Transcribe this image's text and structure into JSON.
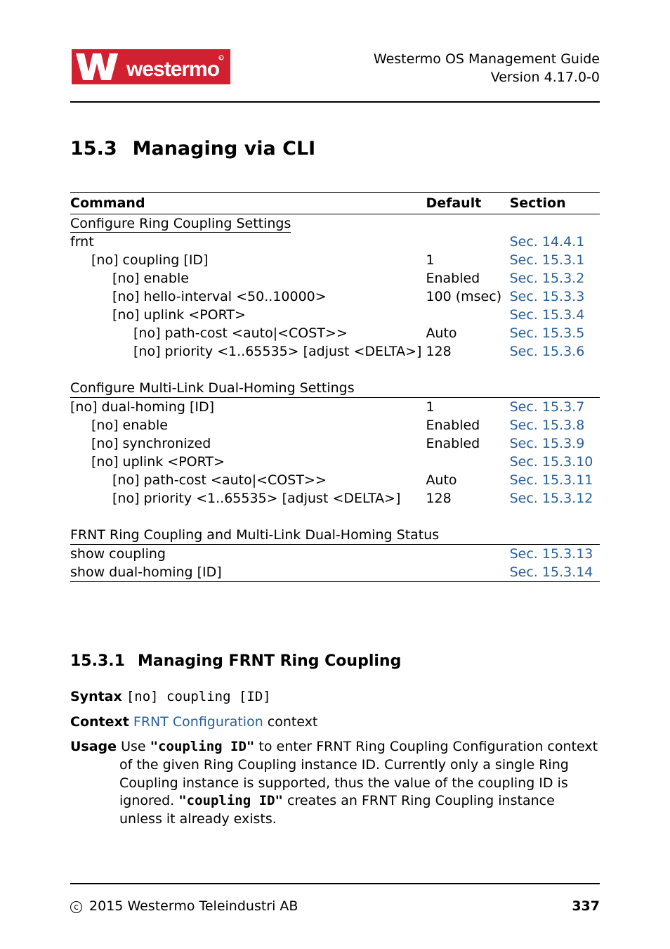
{
  "header": {
    "doc_title": "Westermo OS Management Guide",
    "doc_version": "Version 4.17.0-0",
    "logo_text": "westermo"
  },
  "section": {
    "number": "15.3",
    "title": "Managing via CLI"
  },
  "table": {
    "head_command": "Command",
    "head_default": "Default",
    "head_section": "Section",
    "group1_title": "Configure Ring Coupling Settings",
    "rows1": [
      {
        "cmd": "frnt",
        "indent": 0,
        "default": "",
        "section": "Sec. 14.4.1"
      },
      {
        "cmd": "[no] coupling [ID]",
        "indent": 1,
        "default": "1",
        "section": "Sec. 15.3.1"
      },
      {
        "cmd": "[no] enable",
        "indent": 2,
        "default": "Enabled",
        "section": "Sec. 15.3.2"
      },
      {
        "cmd": "[no] hello-interval <50..10000>",
        "indent": 2,
        "default": "100 (msec)",
        "section": "Sec. 15.3.3"
      },
      {
        "cmd": "[no] uplink <PORT>",
        "indent": 2,
        "default": "",
        "section": "Sec. 15.3.4"
      },
      {
        "cmd": "[no] path-cost <auto|<COST>>",
        "indent": 3,
        "default": "Auto",
        "section": "Sec. 15.3.5"
      },
      {
        "cmd": "[no] priority <1..65535> [adjust <DELTA>]",
        "indent": 3,
        "default": "128",
        "section": "Sec. 15.3.6"
      }
    ],
    "group2_title": "Configure Multi-Link Dual-Homing Settings",
    "rows2": [
      {
        "cmd": "[no] dual-homing [ID]",
        "indent": 0,
        "default": "1",
        "section": "Sec. 15.3.7"
      },
      {
        "cmd": "[no] enable",
        "indent": 1,
        "default": "Enabled",
        "section": "Sec. 15.3.8"
      },
      {
        "cmd": "[no] synchronized",
        "indent": 1,
        "default": "Enabled",
        "section": "Sec. 15.3.9"
      },
      {
        "cmd": "[no] uplink <PORT>",
        "indent": 1,
        "default": "",
        "section": "Sec. 15.3.10"
      },
      {
        "cmd": "[no] path-cost <auto|<COST>>",
        "indent": 2,
        "default": "Auto",
        "section": "Sec. 15.3.11"
      },
      {
        "cmd": "[no] priority <1..65535> [adjust <DELTA>]",
        "indent": 2,
        "default": "128",
        "section": "Sec. 15.3.12"
      }
    ],
    "group3_title": "FRNT Ring Coupling and Multi-Link Dual-Homing Status",
    "rows3": [
      {
        "cmd": "show coupling",
        "indent": 0,
        "default": "",
        "section": "Sec. 15.3.13"
      },
      {
        "cmd": "show dual-homing [ID]",
        "indent": 0,
        "default": "",
        "section": "Sec. 15.3.14"
      }
    ]
  },
  "subsection": {
    "number": "15.3.1",
    "title": "Managing FRNT Ring Coupling",
    "syntax_label": "Syntax",
    "syntax_value": "[no] coupling [ID]",
    "context_label": "Context",
    "context_link": "FRNT Configuration",
    "context_tail": " context",
    "usage_label": "Usage",
    "usage_1a": "Use ",
    "usage_1b": "\"coupling ID\"",
    "usage_1c": " to enter FRNT Ring Coupling Configuration context of the given Ring Coupling instance ID. Currently only a single Ring Coupling instance is supported, thus the value of the coupling ID is ignored. ",
    "usage_1d": "\"coupling ID\"",
    "usage_1e": " creates an FRNT Ring Coupling instance unless it already exists."
  },
  "footer": {
    "copyright": "2015 Westermo Teleindustri AB",
    "page": "337"
  }
}
